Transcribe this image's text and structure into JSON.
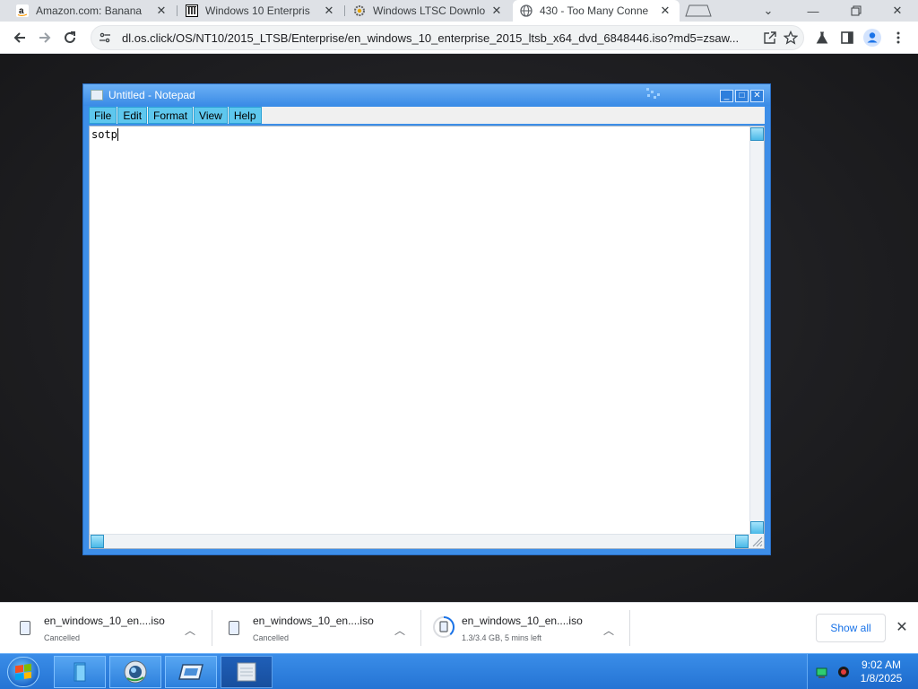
{
  "browser": {
    "tabs": [
      {
        "title": "Amazon.com: Banana",
        "favicon": "amazon-icon",
        "active": false
      },
      {
        "title": "Windows 10 Enterpris",
        "favicon": "archive-icon",
        "active": false
      },
      {
        "title": "Windows LTSC Downlo",
        "favicon": "gear-icon",
        "active": false
      },
      {
        "title": "430 - Too Many Conne",
        "favicon": "globe-icon",
        "active": true
      }
    ],
    "url": "dl.os.click/OS/NT10/2015_LTSB/Enterprise/en_windows_10_enterprise_2015_ltsb_x64_dvd_6848446.iso?md5=zsaw..."
  },
  "notepad": {
    "title": "Untitled - Notepad",
    "menu": [
      "File",
      "Edit",
      "Format",
      "View",
      "Help"
    ],
    "content": "sotp"
  },
  "downloads": {
    "items": [
      {
        "name": "en_windows_10_en....iso",
        "status": "Cancelled"
      },
      {
        "name": "en_windows_10_en....iso",
        "status": "Cancelled"
      },
      {
        "name": "en_windows_10_en....iso",
        "status": "1.3/3.4 GB, 5 mins left"
      }
    ],
    "show_all_label": "Show all"
  },
  "taskbar": {
    "time": "9:02 AM",
    "date": "1/8/2025"
  },
  "colors": {
    "taskbar": "#2c7fdc",
    "notepad_frame": "#3d8ee8",
    "menu_item": "#5ec7ee",
    "link": "#1a73e8"
  }
}
